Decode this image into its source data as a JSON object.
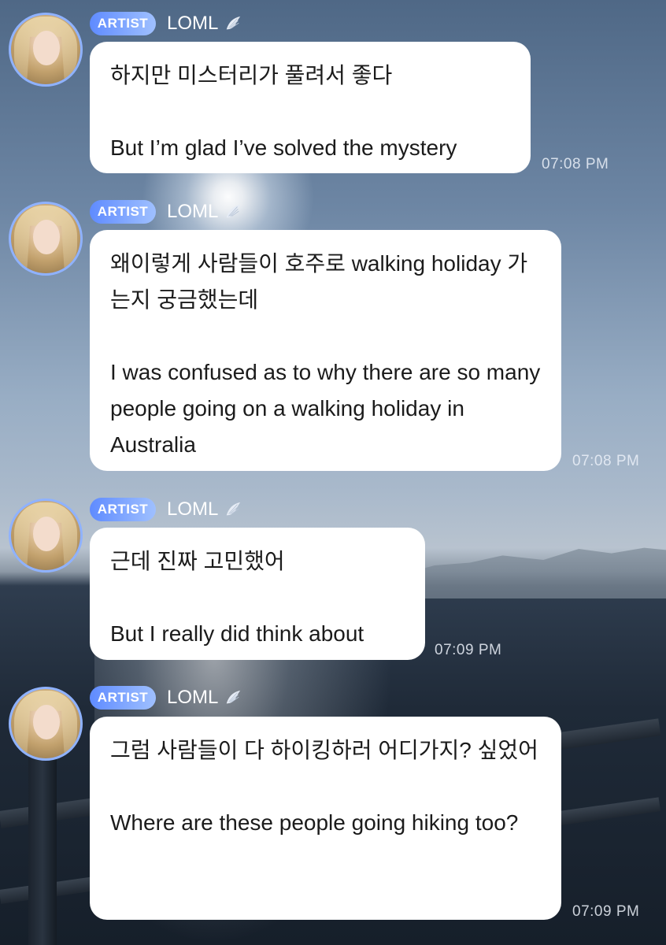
{
  "messages": [
    {
      "badge": "ARTIST",
      "sender": "LOML",
      "korean": "하지만 미스터리가 풀려서 좋다",
      "english": "But I’m glad I’ve solved the mystery",
      "time": "07:08 PM"
    },
    {
      "badge": "ARTIST",
      "sender": "LOML",
      "korean": "왜이렇게 사람들이 호주로 walking holiday 가는지 궁금했는데",
      "english": "I was confused as to why there are so many people going on a walking holiday in Australia",
      "time": "07:08 PM"
    },
    {
      "badge": "ARTIST",
      "sender": "LOML",
      "korean": "근데 진짜 고민했어",
      "english": "But I really did think about",
      "time": "07:09 PM"
    },
    {
      "badge": "ARTIST",
      "sender": "LOML",
      "korean": "그럼 사람들이 다 하이킹하러 어디가지? 싶었어",
      "english": "Where are these people going hiking too?",
      "time": "07:09 PM"
    }
  ],
  "colors": {
    "badge_start": "#5f8bff",
    "badge_end": "#9fc0ff",
    "avatar_ring": "#8fb2ff",
    "bubble": "#ffffff"
  },
  "icons": {
    "verified": "angel-wing-icon"
  }
}
